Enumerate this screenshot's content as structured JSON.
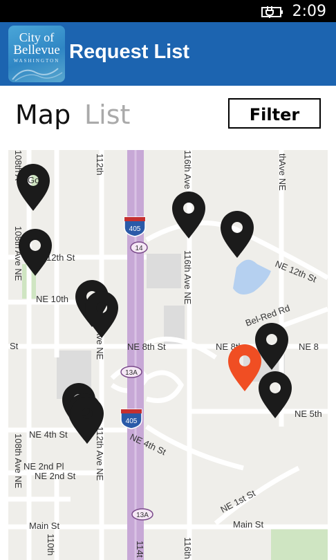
{
  "status_bar": {
    "time": "2:09",
    "battery_icon": "battery-charging-icon"
  },
  "header": {
    "logo_line1": "City of",
    "logo_line2": "Bellevue",
    "logo_line3": "WASHINGTON",
    "title": "Request List"
  },
  "tabs": [
    {
      "label": "Map",
      "active": true
    },
    {
      "label": "List",
      "active": false
    }
  ],
  "filter_label": "Filter",
  "map": {
    "street_labels": {
      "ne_12th": "NE 12th St",
      "ne_12th_left": "12th St",
      "ne_10th": "NE 10th",
      "st_left": "St",
      "ne_8th": "NE 8th St",
      "ne_8th_right": "NE 8th",
      "ne_8_edge": "NE 8",
      "ne_5th": "NE 5th",
      "ne_4th": "NE 4th St",
      "ne_4th_mid": "NE 4th St",
      "ne_2nd_pl": "NE 2nd Pl",
      "ne_2nd": "NE 2nd St",
      "ne_1st": "NE 1st St",
      "main_left": "Main St",
      "main_right": "Main St",
      "ave_108": "108th Ave NE",
      "ave_108_top": "108th A",
      "ave_112": "112th Ave NE",
      "ave_112_top": "112th",
      "ave_116": "116th Ave NE",
      "ave_116_top": "116th Ave",
      "ave_110": "110th",
      "ave_114": "114t",
      "ave_116_bottom": "116th",
      "ave_right": "Ave NE",
      "ave_right_top": "th",
      "bel_red": "Bel-Red Rd",
      "gov": "Gov"
    },
    "shields": {
      "i405_top": "405",
      "i405_mid": "405",
      "sr14": "14",
      "exit13a_top": "13A",
      "exit13a_bottom": "13A"
    },
    "pins_black_count": 11,
    "pins_selected_count": 1,
    "pin_colors": {
      "default": "#1b1b1b",
      "selected": "#f04e23"
    }
  }
}
